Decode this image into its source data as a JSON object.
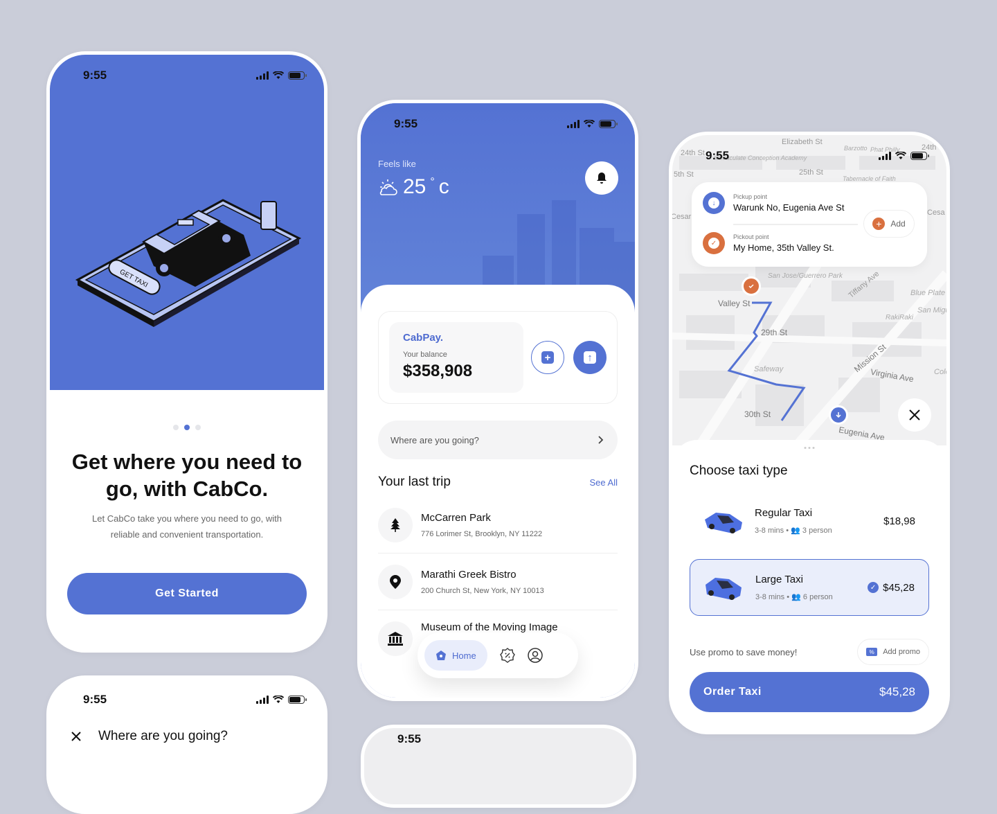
{
  "status_bar": {
    "time": "9:55"
  },
  "onboarding": {
    "illustration_label": "GET TAXI",
    "page_indicator": {
      "total": 3,
      "active": 2
    },
    "title": "Get where you need to go, with CabCo.",
    "subtitle": "Let CabCo take you where you need to go, with reliable and convenient transportation.",
    "cta_label": "Get Started"
  },
  "home": {
    "weather": {
      "label": "Feels like",
      "temperature": "25",
      "unit": "c",
      "icon": "partly-sunny-icon"
    },
    "wallet": {
      "brand": "CabPay.",
      "balance_label": "Your balance",
      "balance": "$358,908"
    },
    "search": {
      "placeholder": "Where are you going?"
    },
    "last_trip": {
      "title": "Your last trip",
      "see_all": "See All",
      "items": [
        {
          "name": "McCarren Park",
          "address": "776 Lorimer St, Brooklyn, NY 11222",
          "icon": "tree-icon"
        },
        {
          "name": "Marathi Greek Bistro",
          "address": "200 Church St, New York, NY 10013",
          "icon": "location-pin-icon"
        },
        {
          "name": "Museum of the Moving Image",
          "address": "",
          "icon": "museum-icon"
        }
      ]
    },
    "nav": {
      "home_label": "Home"
    }
  },
  "booking": {
    "pickup": {
      "label": "Pickup point",
      "value": "Warunk No, Eugenia Ave St"
    },
    "pickout": {
      "label": "Pickout point",
      "value": "My Home, 35th Valley St."
    },
    "add_label": "Add",
    "map_labels": [
      "Elizabeth St",
      "24th St",
      "Immaculate Conception Academy",
      "25th St",
      "5th St",
      "Barzotto",
      "Phat Philly",
      "24th",
      "Tabernacle of Faith",
      "Cesar",
      "Cesa",
      "San Jose/Guerrero Park",
      "Valley St",
      "Tiffany Ave",
      "Blue Plate",
      "San Miguel",
      "RakiRaki",
      "29th St",
      "Mission St",
      "Safeway",
      "Virginia Ave",
      "Cole",
      "30th St",
      "Eugenia Ave"
    ],
    "sheet_title": "Choose taxi type",
    "taxis": [
      {
        "name": "Regular Taxi",
        "eta": "3-8 mins",
        "capacity": "3 person",
        "price": "$18,98",
        "selected": false
      },
      {
        "name": "Large Taxi",
        "eta": "3-8 mins",
        "capacity": "6 person",
        "price": "$45,28",
        "selected": true
      }
    ],
    "promo_text": "Use promo to save money!",
    "promo_button": "Add promo",
    "order_label": "Order Taxi",
    "order_price": "$45,28"
  },
  "search_screen": {
    "title": "Where are you going?"
  },
  "colors": {
    "primary": "#5472d3",
    "accent_orange": "#d9703f",
    "background": "#cacdd9"
  }
}
